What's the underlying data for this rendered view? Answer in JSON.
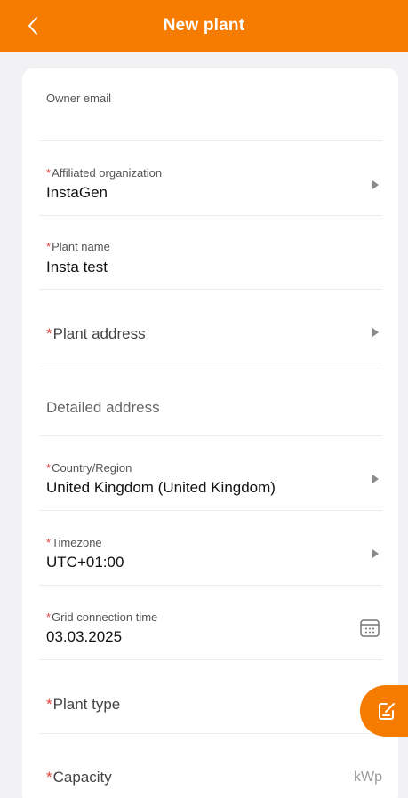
{
  "header": {
    "title": "New plant",
    "accent": "#f57c00"
  },
  "form": {
    "owner_email": {
      "label": "Owner email",
      "value": ""
    },
    "affiliated_org": {
      "label": "Affiliated organization",
      "value": "InstaGen"
    },
    "plant_name": {
      "label": "Plant name",
      "value": "Insta test"
    },
    "plant_address": {
      "label": "Plant address"
    },
    "detailed_address": {
      "placeholder": "Detailed address"
    },
    "country_region": {
      "label": "Country/Region",
      "value": "United Kingdom (United Kingdom)"
    },
    "timezone": {
      "label": "Timezone",
      "value": "UTC+01:00"
    },
    "grid_connection_time": {
      "label": "Grid connection time",
      "value": "03.03.2025"
    },
    "plant_type": {
      "label": "Plant type"
    },
    "capacity": {
      "label": "Capacity",
      "unit": "kWp"
    }
  },
  "required_marker": "*",
  "icons": {
    "back": "chevron-left-icon",
    "chevron": "chevron-right-icon",
    "calendar": "calendar-icon",
    "fab": "edit-note-icon"
  }
}
